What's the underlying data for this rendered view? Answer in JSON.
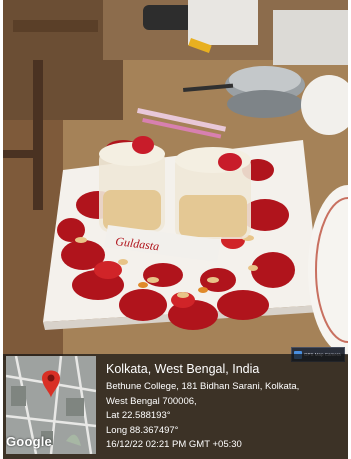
{
  "photo": {
    "place_card": "Guldasta"
  },
  "geotag": {
    "app_badge": "GPS Map Camera",
    "map_brand": "Google",
    "city": "Kolkata, West Bengal, India",
    "address_line1": "Bethune College, 181 Bidhan Sarani, Kolkata,",
    "address_line2": "West Bengal 700006,",
    "latitude": "Lat 22.588193°",
    "longitude": "Long 88.367497°",
    "timestamp": "16/12/22 02:21 PM GMT +05:30"
  }
}
